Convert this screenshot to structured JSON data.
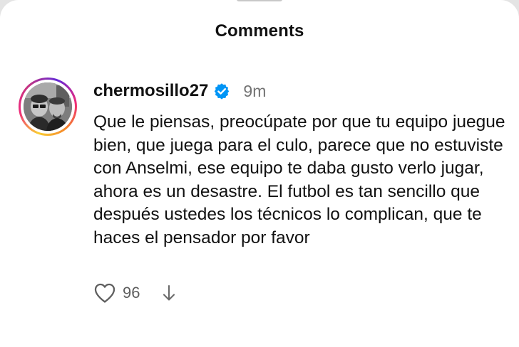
{
  "sheet": {
    "title": "Comments"
  },
  "comment": {
    "avatar_icon": "profile-photo-avatar",
    "username": "chermosillo27",
    "verified_icon": "verified-badge-icon",
    "timestamp": "9m",
    "text": "Que le piensas, preocúpate por que tu equipo juegue bien, que juega para el culo, parece que no estuviste con Anselmi, ese equipo te daba gusto verlo jugar, ahora es un desastre. El futbol es tan sencillo que después ustedes los técnicos lo complican, que te haces el pensador por favor",
    "like_icon": "heart-icon",
    "like_count": "96",
    "downvote_icon": "arrow-down-icon"
  },
  "colors": {
    "verified": "#0095f6",
    "secondary_text": "#737373",
    "primary_text": "#111111"
  }
}
